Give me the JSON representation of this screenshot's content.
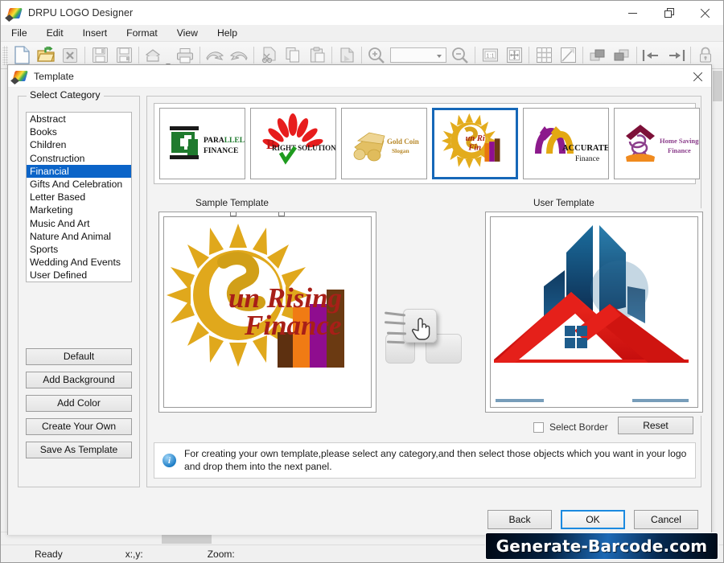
{
  "window": {
    "title": "DRPU LOGO Designer",
    "controls": {
      "minimize": "minimize-icon",
      "maximize": "maximize-icon",
      "close": "close-icon"
    }
  },
  "menu": {
    "items": [
      "File",
      "Edit",
      "Insert",
      "Format",
      "View",
      "Help"
    ]
  },
  "toolbar": {
    "zoom_combo_value": "",
    "icons": [
      "new-document-icon",
      "open-folder-icon",
      "close-document-icon",
      "save-icon",
      "save-as-icon",
      "export-icon",
      "print-icon",
      "undo-icon",
      "redo-icon",
      "cut-icon",
      "copy-icon",
      "paste-icon",
      "delete-icon",
      "zoom-in-icon",
      "zoom-out-icon",
      "actual-size-icon",
      "fit-page-icon",
      "grid-icon",
      "design-icon",
      "bring-front-icon",
      "send-back-icon",
      "align-left-icon",
      "align-right-icon",
      "lock-icon",
      "unlock-icon"
    ]
  },
  "dialog": {
    "title": "Template",
    "close_icon": "close-icon",
    "category": {
      "legend": "Select Category",
      "items": [
        "Abstract",
        "Books",
        "Children",
        "Construction",
        "Financial",
        "Gifts And Celebration",
        "Letter Based",
        "Marketing",
        "Music And Art",
        "Nature And Animal",
        "Sports",
        "Wedding And Events",
        "User Defined"
      ],
      "selected": "Financial",
      "selected_index": 4,
      "buttons": [
        "Default",
        "Add Background",
        "Add Color",
        "Create Your Own",
        "Save As Template"
      ]
    },
    "thumbnails": [
      {
        "name": "parallel-finance",
        "line1": "PARALLEL",
        "line2": "FINANCE",
        "selected": false
      },
      {
        "name": "bright-solution",
        "line1": "BRIGHT SOLUTION",
        "line2": "",
        "selected": false
      },
      {
        "name": "gold-coin",
        "line1": "Gold Coin",
        "line2": "Slogan",
        "selected": false
      },
      {
        "name": "sun-rising-finance",
        "line1": "Sun Rising",
        "line2": "Finance",
        "selected": true
      },
      {
        "name": "accurate-finance",
        "line1": "ACCURATE",
        "line2": "Finance",
        "selected": false
      },
      {
        "name": "home-savings-finance",
        "line1": "Home Savings",
        "line2": "Finance",
        "selected": false
      }
    ],
    "panels": {
      "sample_caption": "Sample Template",
      "user_caption": "User Template",
      "sample_logo": {
        "line1": "Sun Rising",
        "line2": "Finance",
        "icon": "sun-logo-icon"
      },
      "user_logo": {
        "icon": "building-house-logo-icon"
      },
      "drag_hint_icon": "drag-drop-hand-icon"
    },
    "select_border": {
      "label": "Select Border",
      "checked": false
    },
    "reset_button": "Reset",
    "info": {
      "icon": "info-icon",
      "glyph": "i",
      "text": "For creating your own template,please select any category,and then select those objects which you want in your logo and drop them into the next panel."
    },
    "buttons": {
      "back": "Back",
      "ok": "OK",
      "cancel": "Cancel",
      "default": "OK"
    }
  },
  "statusbar": {
    "ready": "Ready",
    "coords": "x:,y:",
    "zoom": "Zoom:"
  },
  "watermark": {
    "text": "Generate-Barcode.com"
  },
  "colors": {
    "selection_blue": "#0b64c8",
    "thumb_selected_border": "#1668b8",
    "default_button_border": "#1b8ae0",
    "sun_gold": "#e0a81c",
    "sun_text_red": "#a81f18",
    "house_red": "#e31f17",
    "building_blue": "#17557f"
  }
}
